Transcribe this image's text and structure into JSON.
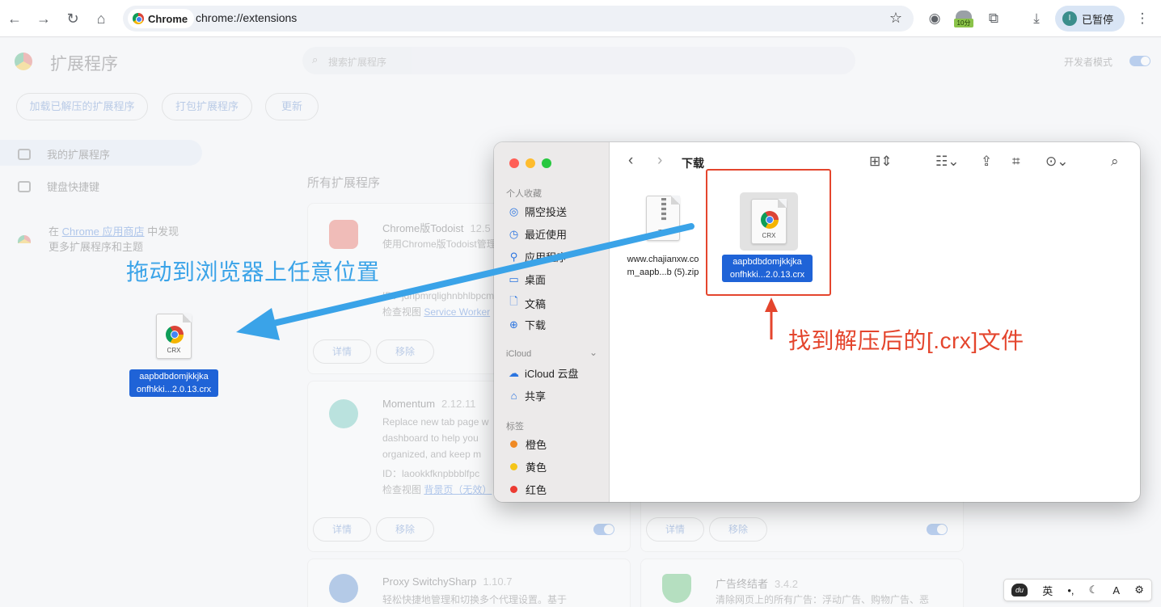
{
  "browser": {
    "chip_label": "Chrome",
    "url": "chrome://extensions",
    "ext_badge": "10分",
    "profile_initial": "I",
    "profile_label": "已暂停"
  },
  "page": {
    "title": "扩展程序",
    "search_placeholder": "搜索扩展程序",
    "dev_mode_label": "开发者模式",
    "actions": [
      "加载已解压的扩展程序",
      "打包扩展程序",
      "更新"
    ],
    "sidebar": {
      "my_extensions": "我的扩展程序",
      "shortcuts": "键盘快捷键",
      "store_prefix": "在",
      "store_link": "Chrome 应用商店",
      "store_suffix": "中发现",
      "store_line2": "更多扩展程序和主题"
    },
    "section_title": "所有扩展程序",
    "cards": [
      {
        "name": "Chrome版Todoist",
        "version": "12.5",
        "desc1": "使用Chrome版Todoist管理",
        "desc2": "ID：jdnpmrqlighnbhlbpcm",
        "desc3_prefix": "检查视图",
        "desc3_link": "Service Worker",
        "details": "详情",
        "remove": "移除"
      },
      {
        "name": "Momentum",
        "version": "2.12.11",
        "desc1": "Replace new tab page w",
        "desc2": "dashboard to help you",
        "desc3": "organized, and keep m",
        "desc4": "ID：laookkfknpbbblfpc",
        "desc5_prefix": "检查视图",
        "desc5_link": "背景页（无效）",
        "details": "详情",
        "remove": "移除"
      },
      {
        "details": "详情",
        "remove": "移除"
      },
      {
        "name": "Proxy SwitchySharp",
        "version": "1.10.7",
        "desc1": "轻松快捷地管理和切换多个代理设置。基于"
      },
      {
        "name": "广告终结者",
        "version": "3.4.2",
        "desc1": "清除网页上的所有广告：浮动广告、购物广告、恶"
      }
    ]
  },
  "annotations": {
    "drag_hint": "拖动到浏览器上任意位置",
    "find_hint": "找到解压后的[.crx]文件"
  },
  "dragged_file": {
    "ext_label": "CRX",
    "name_line1": "aapbdbdomjkkjka",
    "name_line2": "onfhkki...2.0.13.crx"
  },
  "finder": {
    "title": "下载",
    "favorites_header": "个人收藏",
    "favorites": [
      "隔空投送",
      "最近使用",
      "应用程序",
      "桌面",
      "文稿",
      "下载"
    ],
    "icloud_header": "iCloud",
    "icloud_items": [
      "iCloud 云盘",
      "共享"
    ],
    "tags_header": "标签",
    "tags": [
      {
        "label": "橙色",
        "color": "#f08a24"
      },
      {
        "label": "黄色",
        "color": "#f5c518"
      },
      {
        "label": "红色",
        "color": "#ec3b32"
      }
    ],
    "files": [
      {
        "ext": "ZIP",
        "name_line1": "www.chajianxw.co",
        "name_line2": "m_aapb...b (5).zip"
      },
      {
        "ext": "CRX",
        "name_line1": "aapbdbdomjkkjka",
        "name_line2": "onfhkki...2.0.13.crx"
      }
    ]
  },
  "ime": {
    "paw": "du",
    "lang": "英"
  },
  "colors": {
    "accent_blue": "#3aa3e8",
    "annotation_red": "#e4452d",
    "selection_blue": "#1f63d7"
  }
}
